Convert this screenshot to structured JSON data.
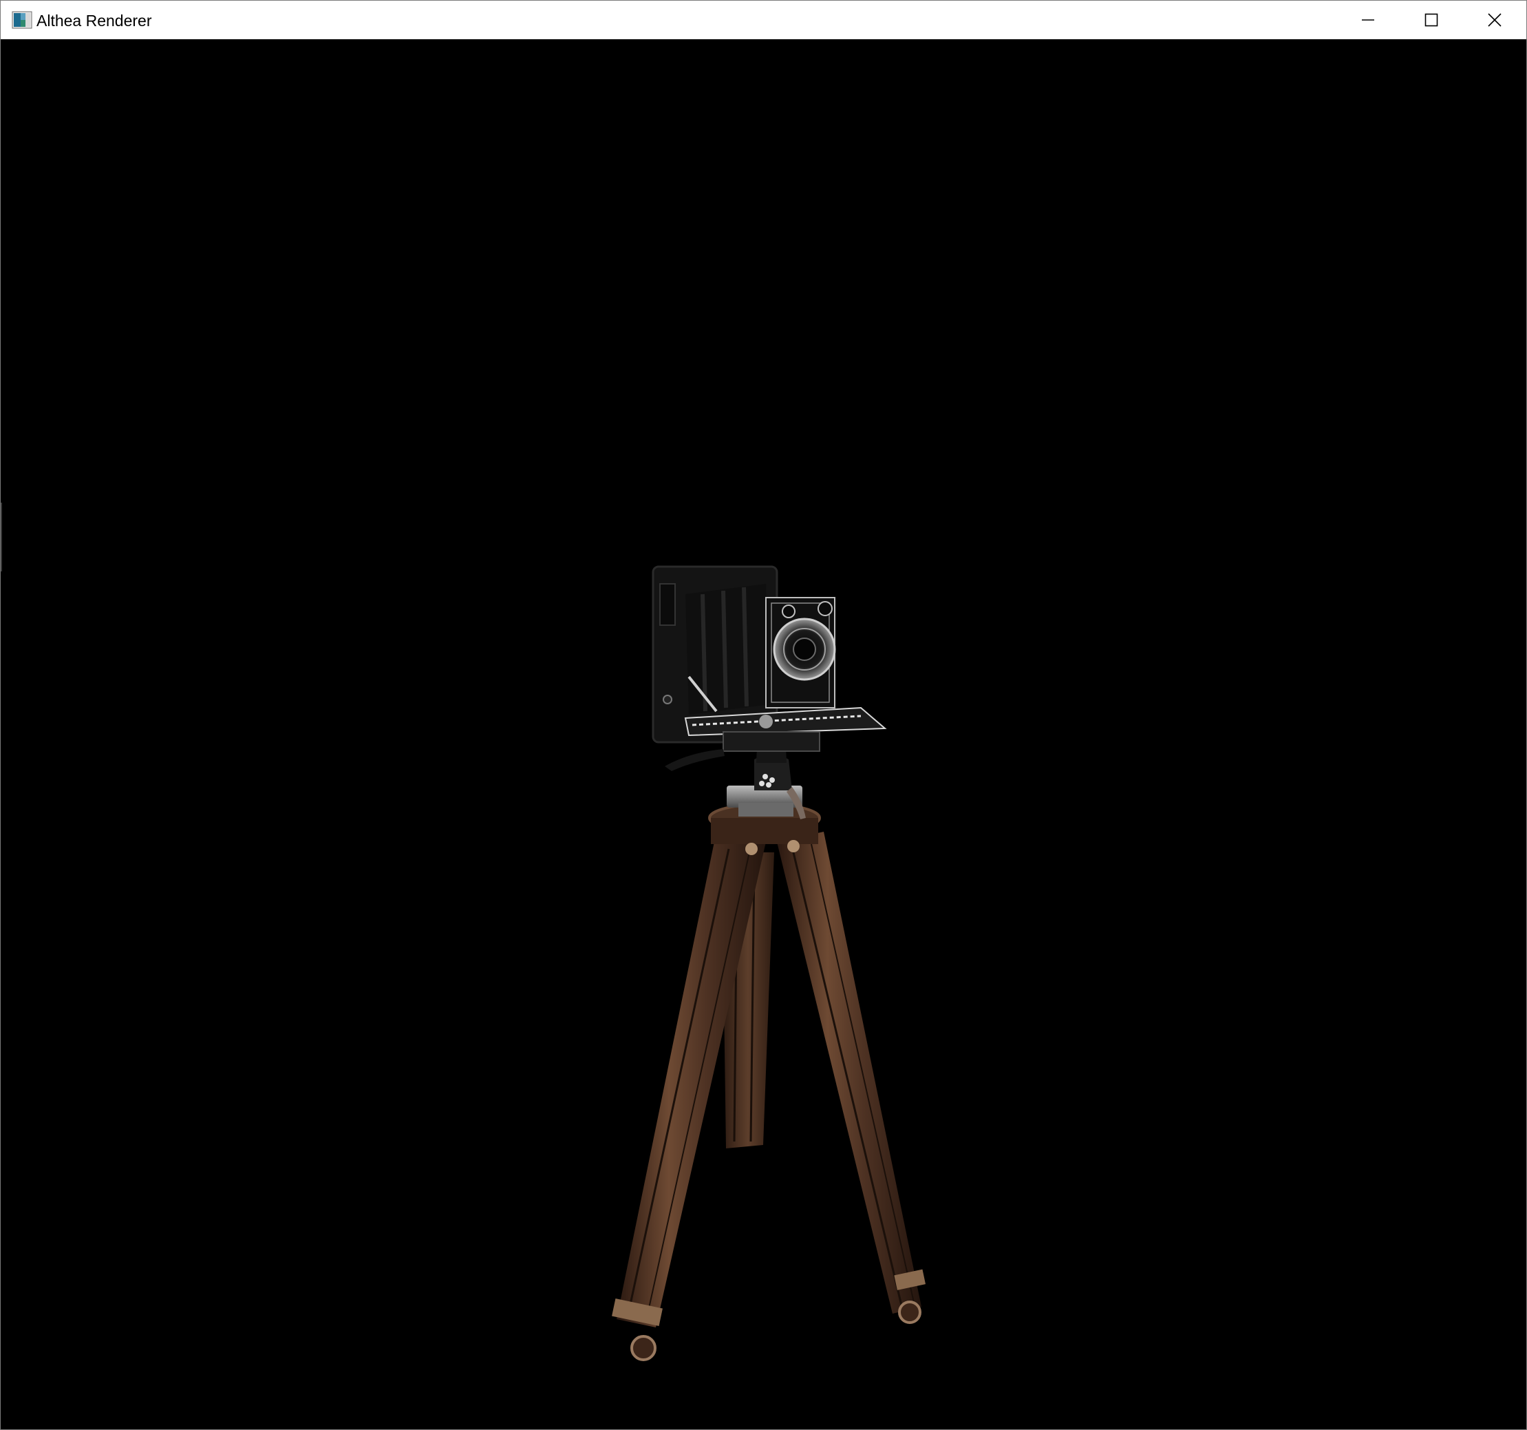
{
  "window": {
    "title": "Althea Renderer",
    "icon": "app-icon"
  },
  "controls": {
    "minimize_icon": "minimize-icon",
    "maximize_icon": "maximize-icon",
    "close_icon": "close-icon"
  },
  "viewport": {
    "background": "#000000",
    "scene_subject": "folding-camera-on-wooden-tripod",
    "colors": {
      "camera_body": "#141414",
      "camera_highlight": "#bfbfbf",
      "wood_dark": "#3a2418",
      "wood_light": "#6e4a33",
      "brass": "#a08060",
      "metal": "#8a8a8a"
    }
  }
}
